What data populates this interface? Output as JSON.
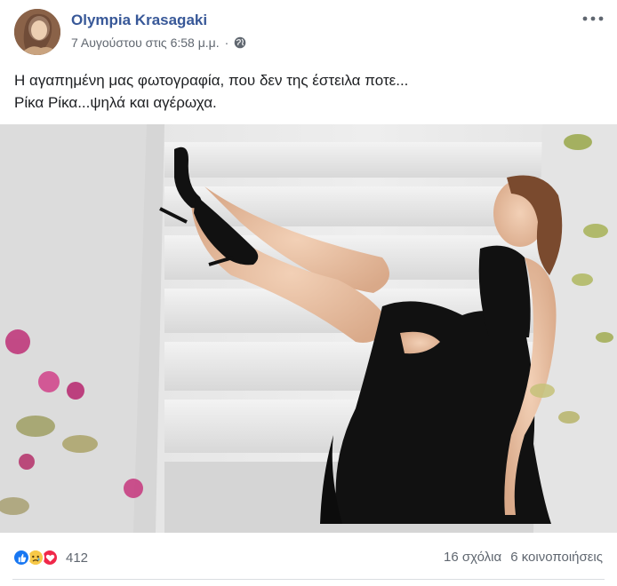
{
  "post": {
    "author": "Olympia Krasagaki",
    "timestamp": "7 Αυγούστου στις 6:58 μ.μ.",
    "separator": "·",
    "privacy_icon": "globe-icon",
    "more_icon": "more-options-icon",
    "text_lines": [
      "Η αγαπημένη μας φωτογραφία, που δεν της έστειλα ποτε...",
      "Ρίκα Ρίκα...ψηλά και αγέρωχα."
    ]
  },
  "reactions": {
    "icons": [
      "like-icon",
      "sad-icon",
      "love-icon"
    ],
    "count": "412"
  },
  "stats": {
    "comments": "16 σχόλια",
    "shares": "6 κοινοποιήσεις"
  },
  "colors": {
    "author_link": "#385898",
    "secondary_text": "#606770",
    "like_blue": "#1877f2",
    "love_red": "#f0284a",
    "sad_yellow": "#f7c948"
  }
}
